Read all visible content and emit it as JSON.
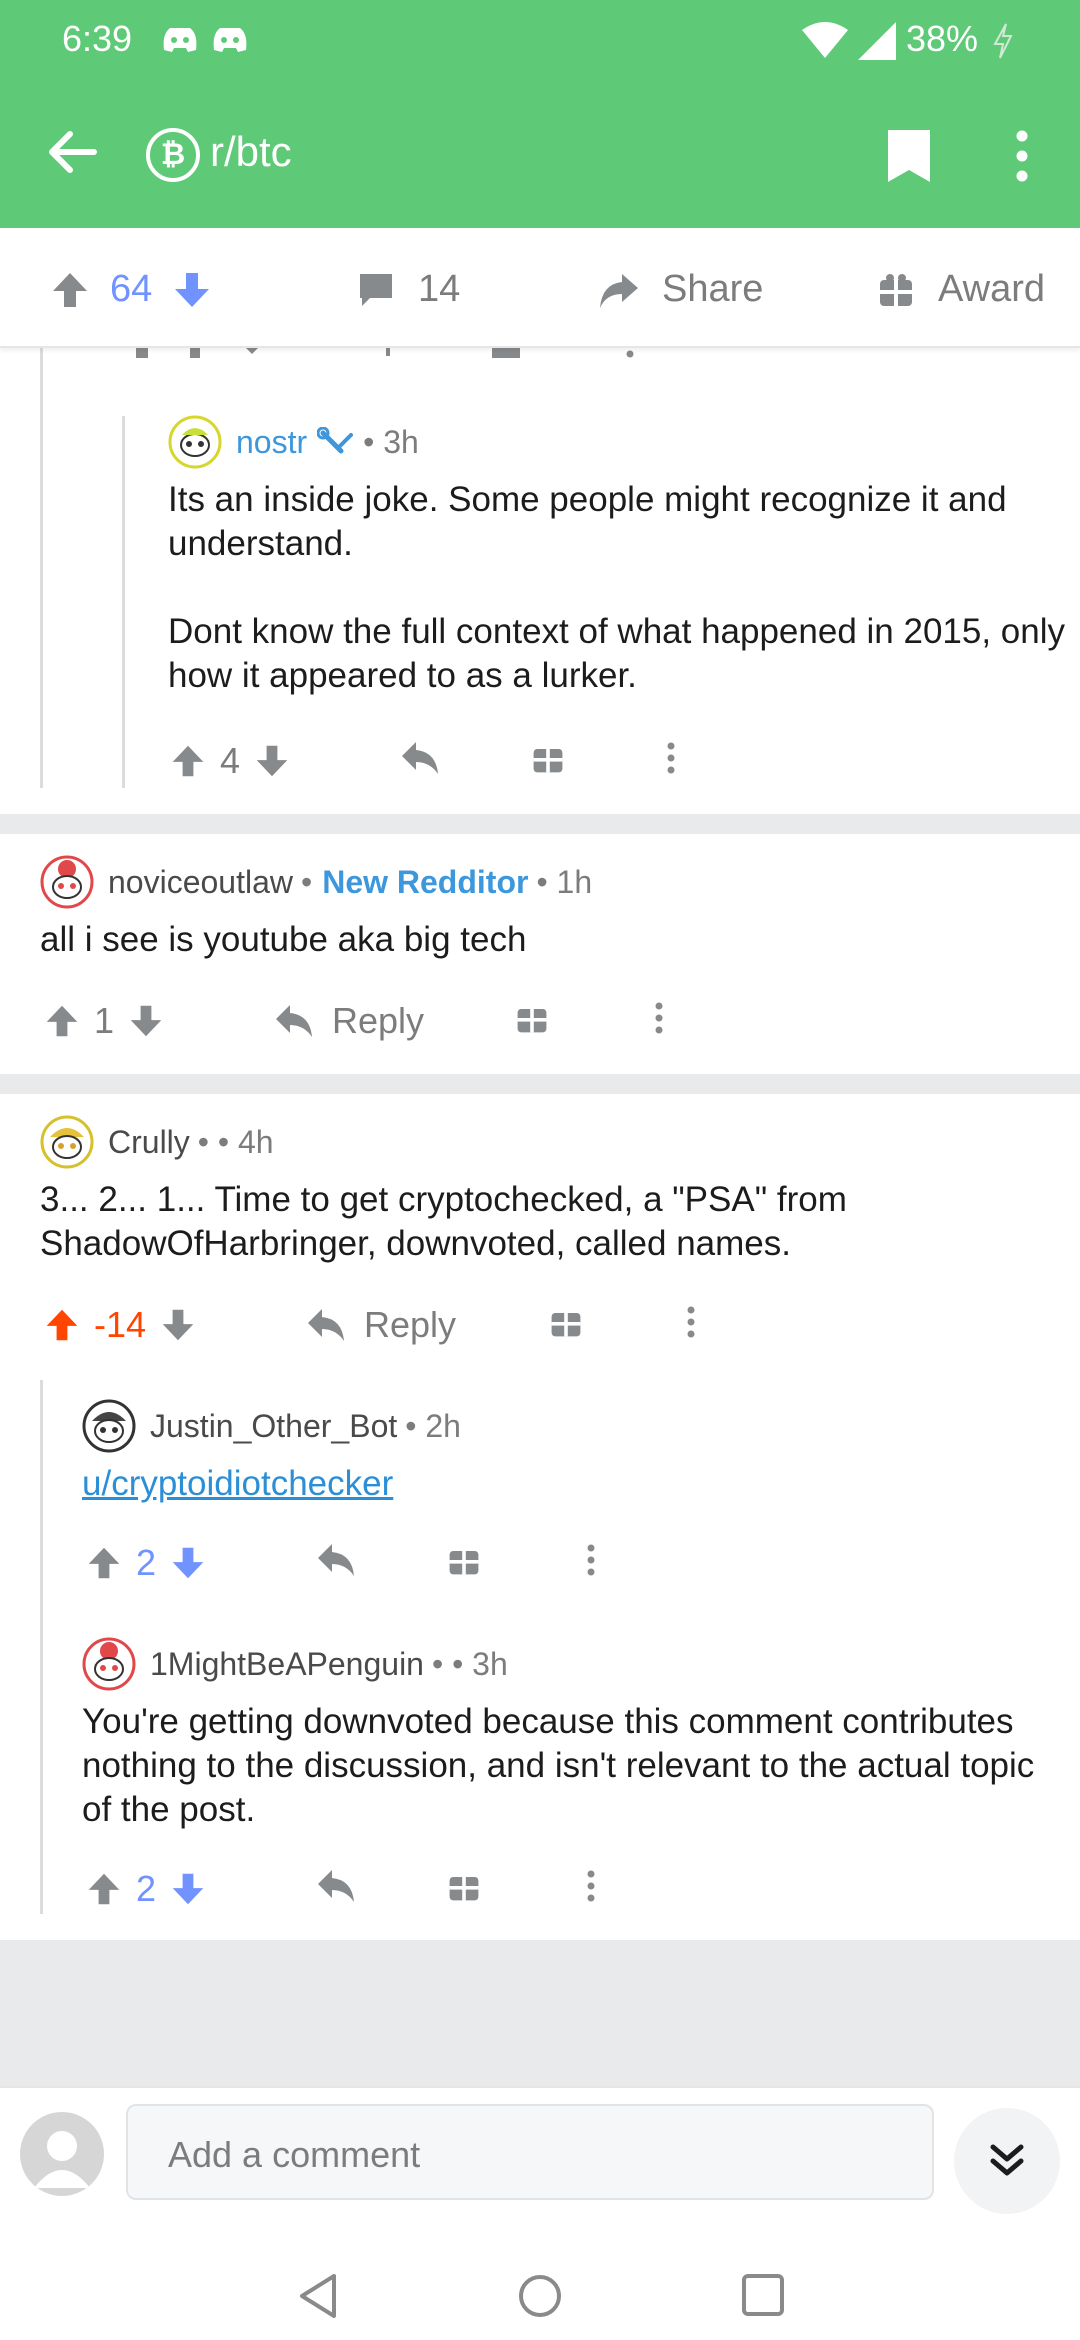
{
  "status": {
    "time": "6:39",
    "battery": "38%"
  },
  "app": {
    "subreddit": "r/btc",
    "subreddit_icon": "₿"
  },
  "post_bar": {
    "score": "64",
    "comments": "14",
    "share": "Share",
    "award": "Award"
  },
  "comments": [
    {
      "user": "nostr",
      "meta": "• 3h",
      "body": [
        "Its an inside joke. Some people might recognize it and understand.",
        "Dont know the full context of what happened in 2015, only how it appeared to as a lurker."
      ],
      "score": "4"
    },
    {
      "user": "noviceoutlaw",
      "flair": "New Redditor",
      "meta": "• 1h",
      "body": "all i see is youtube aka big tech",
      "score": "1",
      "reply": "Reply"
    },
    {
      "user": "Crully",
      "meta": "• • 4h",
      "body": "3... 2... 1... Time to get cryptochecked, a \"PSA\" from ShadowOfHarbringer, downvoted, called names.",
      "score": "-14",
      "reply": "Reply"
    },
    {
      "user": "Justin_Other_Bot",
      "meta": "• 2h",
      "link": "u/cryptoidiotchecker",
      "score": "2"
    },
    {
      "user": "1MightBeAPenguin",
      "meta": "• • 3h",
      "body": "You're getting downvoted because this comment contributes nothing to the discussion, and isn't relevant to the actual topic of the post.",
      "score": "2"
    }
  ],
  "composer": {
    "placeholder": "Add a comment"
  },
  "colors": {
    "accent_green": "#5ec976",
    "upvote_orange": "#ff4500",
    "vote_blue": "#7193ff",
    "link_blue": "#2c8fd6"
  }
}
